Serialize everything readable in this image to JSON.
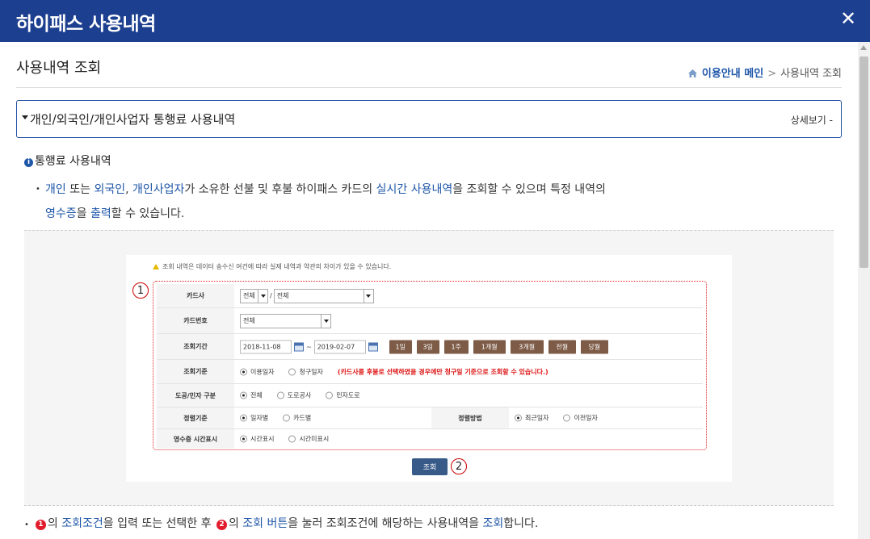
{
  "header": {
    "title": "하이패스 사용내역",
    "close_label": "✕"
  },
  "page": {
    "title": "사용내역 조회",
    "breadcrumb": {
      "home": "이용안내 메인",
      "separator": ">",
      "current": "사용내역 조회"
    }
  },
  "accordion": {
    "label": "개인/외국인/개인사업자 통행료 사용내역",
    "toggle": "상세보기 -"
  },
  "section": {
    "title": "통행료 사용내역",
    "desc": [
      {
        "t": "개인",
        "hl": true
      },
      {
        "t": " 또는 ",
        "hl": false
      },
      {
        "t": "외국인",
        "hl": true
      },
      {
        "t": ", ",
        "hl": false
      },
      {
        "t": "개인사업자",
        "hl": true
      },
      {
        "t": "가 소유한 선불 및 후불 하이패스 카드의 ",
        "hl": false
      },
      {
        "t": "실시간 사용내역",
        "hl": true
      },
      {
        "t": "을 조회할 수 있으며 특정 내역의",
        "hl": false
      }
    ],
    "desc2": [
      {
        "t": "영수증",
        "hl": true
      },
      {
        "t": "을 ",
        "hl": false
      },
      {
        "t": "출력",
        "hl": true
      },
      {
        "t": "할 수 있습니다.",
        "hl": false
      }
    ]
  },
  "guide": {
    "warning": "조회 내역은 데이터 송수신 여건에 따라 실제 내역과 약관의 차이가 있을 수 있습니다.",
    "marker1": "1",
    "marker2": "2",
    "card_company": {
      "label": "카드사",
      "value1": "전체",
      "slash": "/",
      "value2": "전체"
    },
    "card_number": {
      "label": "카드번호",
      "value": "전체"
    },
    "period": {
      "label": "조회기간",
      "from": "2018-11-08",
      "tilde": "~",
      "to": "2019-02-07",
      "buttons": [
        "1일",
        "3일",
        "1주",
        "1개월",
        "3개월",
        "전월",
        "당월"
      ]
    },
    "basis": {
      "label": "조회기준",
      "options": [
        "이용일자",
        "청구일자"
      ],
      "note": "(카드사를 후불로 선택하였을 경우에만 청구일 기준으로 조회할 수 있습니다.)"
    },
    "road": {
      "label": "도공/민자 구분",
      "options": [
        "전체",
        "도로공사",
        "민자도로"
      ]
    },
    "sort_basis": {
      "label": "정렬기준",
      "options": [
        "일자별",
        "카드별"
      ]
    },
    "sort_method": {
      "label": "정렬방법",
      "options": [
        "최근일자",
        "이전일자"
      ]
    },
    "receipt": {
      "label": "영수증 시간표시",
      "options": [
        "시간표시",
        "시간미표시"
      ]
    },
    "search_button": "조회"
  },
  "footnote": {
    "m1": "1",
    "m2": "2",
    "parts": [
      {
        "t": "의 ",
        "hl": false
      },
      {
        "t": "조회조건",
        "hl": true
      },
      {
        "t": "을 입력 또는 선택한 후 ",
        "hl": false
      }
    ],
    "parts2": [
      {
        "t": "의 ",
        "hl": false
      },
      {
        "t": "조회 버튼",
        "hl": true
      },
      {
        "t": "을 눌러 조회조건에 해당하는 사용내역을 ",
        "hl": false
      },
      {
        "t": "조회",
        "hl": true
      },
      {
        "t": "합니다.",
        "hl": false
      }
    ]
  },
  "colors": {
    "header_bg": "#1d3f8f",
    "accent": "#1e56a8",
    "period_button": "#7d5b46",
    "marker_red": "#e21c2c"
  }
}
